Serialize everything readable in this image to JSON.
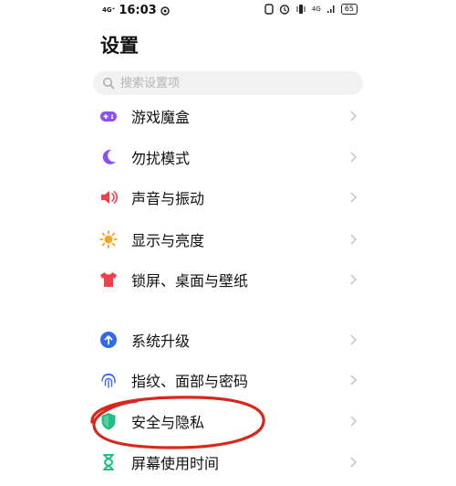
{
  "status_bar": {
    "network_small": "4G⁺",
    "time": "16:03",
    "net_right": "4G",
    "battery": "65"
  },
  "page": {
    "title": "设置"
  },
  "search": {
    "placeholder": "搜索设置项"
  },
  "settings": [
    {
      "label": "游戏魔盒",
      "icon": "game-box-icon",
      "color": "#8a4fff"
    },
    {
      "label": "勿扰模式",
      "icon": "moon-icon",
      "color": "#8a4fff"
    },
    {
      "label": "声音与振动",
      "icon": "speaker-icon",
      "color": "#f0404b"
    },
    {
      "label": "显示与亮度",
      "icon": "sun-icon",
      "color": "#f5a623"
    },
    {
      "label": "锁屏、桌面与壁纸",
      "icon": "shirt-icon",
      "color": "#f0404b"
    },
    {
      "label": "系统升级",
      "icon": "upgrade-icon",
      "color": "#2f6bea"
    },
    {
      "label": "指纹、面部与密码",
      "icon": "fingerprint-icon",
      "color": "#2f6bea"
    },
    {
      "label": "安全与隐私",
      "icon": "shield-icon",
      "color": "#1fbf84"
    },
    {
      "label": "屏幕使用时间",
      "icon": "hourglass-icon",
      "color": "#1fbf84"
    }
  ],
  "annotation": {
    "color": "#d8281e"
  }
}
